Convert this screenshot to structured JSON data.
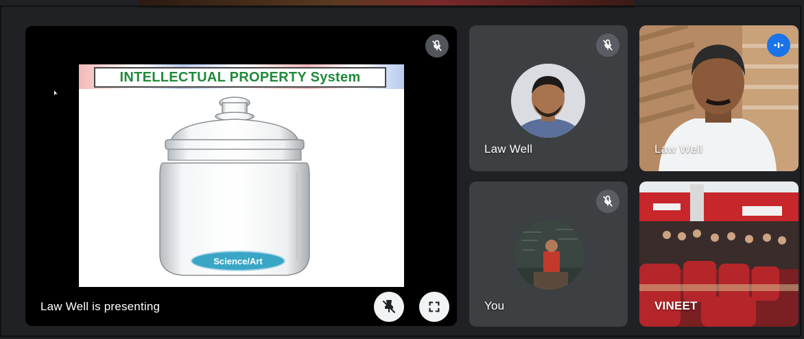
{
  "presentation": {
    "presenter_label": "Law Well is presenting",
    "slide": {
      "title": "INTELLECTUAL PROPERTY System",
      "jar_label": "Science/Art"
    },
    "controls": [
      {
        "name": "unpin",
        "icon": "pin-off-icon"
      },
      {
        "name": "fullscreen",
        "icon": "fullscreen-icon"
      }
    ],
    "mute_icon": "mic-off-icon"
  },
  "participants": [
    {
      "name": "Law Well",
      "muted": true,
      "type": "avatar"
    },
    {
      "name": "Law Well",
      "muted": false,
      "speaking": true,
      "type": "video"
    },
    {
      "name": "You",
      "muted": true,
      "type": "avatar"
    },
    {
      "name": "VINEET",
      "muted": false,
      "type": "video"
    }
  ],
  "colors": {
    "background": "#202124",
    "tile": "#3c4043",
    "mute_badge": "#5f6368",
    "speaking": "#1a73e8",
    "slide_title": "#1f8a3a",
    "label_pill": "#3aa6c6"
  }
}
